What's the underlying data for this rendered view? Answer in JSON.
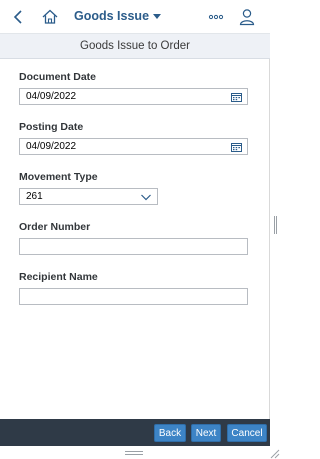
{
  "shell": {
    "title": "Goods Issue",
    "icons": [
      "back-icon",
      "home-icon",
      "more-icon",
      "user-icon"
    ]
  },
  "subheader": {
    "title": "Goods Issue to Order"
  },
  "form": {
    "document_date_label": "Document Date",
    "document_date_value": "04/09/2022",
    "posting_date_label": "Posting Date",
    "posting_date_value": "04/09/2022",
    "movement_type_label": "Movement Type",
    "movement_type_value": "261",
    "order_number_label": "Order Number",
    "order_number_value": "",
    "recipient_name_label": "Recipient Name",
    "recipient_name_value": ""
  },
  "footer": {
    "back_label": "Back",
    "next_label": "Next",
    "cancel_label": "Cancel"
  },
  "colors": {
    "brand": "#2b5c8a",
    "button": "#3d84c6",
    "footer": "#2f3a47",
    "subheader": "#eef1f6"
  }
}
